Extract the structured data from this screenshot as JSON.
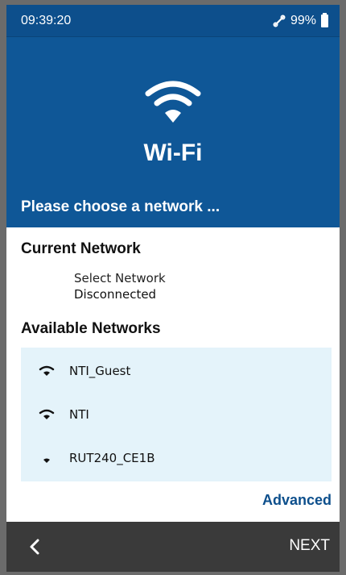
{
  "status": {
    "time": "09:39:20",
    "battery": "99%"
  },
  "header": {
    "title": "Wi-Fi",
    "subtitle": "Please choose a network ..."
  },
  "current": {
    "heading": "Current Network",
    "name": "Select Network",
    "state": "Disconnected"
  },
  "available": {
    "heading": "Available Networks",
    "networks": [
      {
        "ssid": "NTI_Guest",
        "signal": "full"
      },
      {
        "ssid": "NTI",
        "signal": "full"
      },
      {
        "ssid": "RUT240_CE1B",
        "signal": "low"
      }
    ]
  },
  "advanced_label": "Advanced",
  "nav": {
    "next_label": "NEXT"
  },
  "colors": {
    "primary": "#0f5797",
    "list_bg": "#e4f3fa",
    "bottom_bar": "#3a3a3a"
  }
}
